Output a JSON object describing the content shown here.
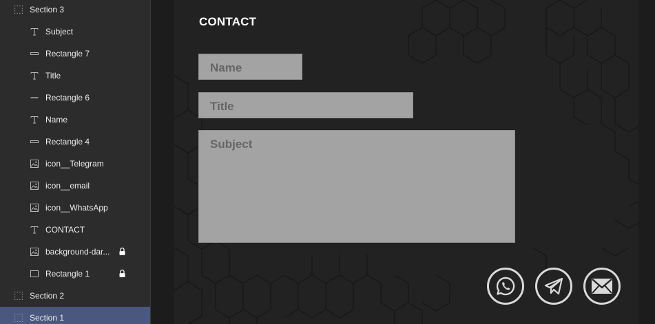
{
  "layers": {
    "items": [
      {
        "label": "Section 3",
        "kind": "section",
        "icon": "frame-icon",
        "selected": false,
        "locked": false
      },
      {
        "label": "Subject",
        "kind": "child",
        "icon": "text-icon",
        "selected": false,
        "locked": false
      },
      {
        "label": "Rectangle 7",
        "kind": "child",
        "icon": "rectangle-thin-icon",
        "selected": false,
        "locked": false
      },
      {
        "label": "Title",
        "kind": "child",
        "icon": "text-icon",
        "selected": false,
        "locked": false
      },
      {
        "label": "Rectangle 6",
        "kind": "child",
        "icon": "line-icon",
        "selected": false,
        "locked": false
      },
      {
        "label": "Name",
        "kind": "child",
        "icon": "text-icon",
        "selected": false,
        "locked": false
      },
      {
        "label": "Rectangle 4",
        "kind": "child",
        "icon": "rectangle-thin-icon",
        "selected": false,
        "locked": false
      },
      {
        "label": "icon__Telegram",
        "kind": "child",
        "icon": "image-icon",
        "selected": false,
        "locked": false
      },
      {
        "label": "icon__email",
        "kind": "child",
        "icon": "image-icon",
        "selected": false,
        "locked": false
      },
      {
        "label": "icon__WhatsApp",
        "kind": "child",
        "icon": "image-icon",
        "selected": false,
        "locked": false
      },
      {
        "label": "CONTACT",
        "kind": "child",
        "icon": "text-icon",
        "selected": false,
        "locked": false
      },
      {
        "label": "background-dar...",
        "kind": "child",
        "icon": "image-icon",
        "selected": false,
        "locked": true
      },
      {
        "label": "Rectangle 1",
        "kind": "child",
        "icon": "rectangle-icon",
        "selected": false,
        "locked": true
      },
      {
        "label": "Section 2",
        "kind": "section",
        "icon": "frame-icon",
        "selected": false,
        "locked": false
      },
      {
        "label": "Section 1",
        "kind": "section",
        "icon": "frame-icon",
        "selected": true,
        "locked": false
      }
    ]
  },
  "canvas": {
    "heading": "CONTACT",
    "fields": {
      "name_placeholder": "Name",
      "title_placeholder": "Title",
      "subject_placeholder": "Subject"
    },
    "social": [
      {
        "icon": "whatsapp-icon"
      },
      {
        "icon": "telegram-icon"
      },
      {
        "icon": "email-icon"
      }
    ]
  },
  "colors": {
    "panel_bg": "#2c2c2c",
    "selected_row": "#4a5880",
    "frame_bg": "#222222",
    "field_bg": "#a3a3a3",
    "field_text": "#666666",
    "icon_stroke": "#d9d9d9"
  }
}
